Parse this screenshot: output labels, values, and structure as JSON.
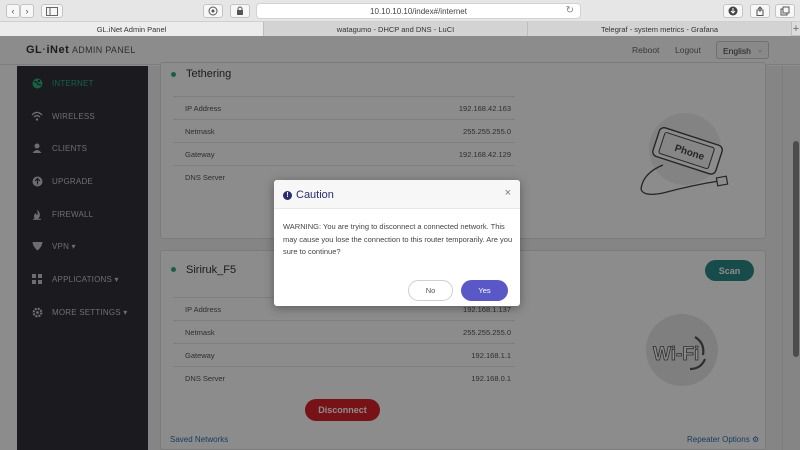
{
  "browser": {
    "url": "10.10.10.10/index#/internet",
    "tabs": [
      {
        "label": "GL.iNet Admin Panel",
        "active": true
      },
      {
        "label": "watagumo - DHCP and DNS - LuCI",
        "active": false
      },
      {
        "label": "Telegraf - system metrics - Grafana",
        "active": false
      }
    ]
  },
  "header": {
    "logo": {
      "part1": "GL",
      "dot": "·",
      "part2": "iNet"
    },
    "admin_title": "ADMIN PANEL",
    "reboot": "Reboot",
    "logout": "Logout",
    "language": "English"
  },
  "sidebar": {
    "items": [
      {
        "label": "INTERNET",
        "icon": "globe-icon",
        "active": true
      },
      {
        "label": "WIRELESS",
        "icon": "wifi-icon",
        "active": false
      },
      {
        "label": "CLIENTS",
        "icon": "user-icon",
        "active": false
      },
      {
        "label": "UPGRADE",
        "icon": "upload-icon",
        "active": false
      },
      {
        "label": "FIREWALL",
        "icon": "flame-icon",
        "active": false
      },
      {
        "label": "VPN ▾",
        "icon": "shield-icon",
        "active": false
      },
      {
        "label": "APPLICATIONS ▾",
        "icon": "grid-icon",
        "active": false
      },
      {
        "label": "MORE SETTINGS ▾",
        "icon": "gear-icon",
        "active": false
      }
    ]
  },
  "tethering": {
    "title": "Tethering",
    "rows": [
      {
        "key": "IP Address",
        "value": "192.168.42.163"
      },
      {
        "key": "Netmask",
        "value": "255.255.255.0"
      },
      {
        "key": "Gateway",
        "value": "192.168.42.129"
      },
      {
        "key": "DNS Server",
        "value": ""
      }
    ],
    "phone_label": "Phone"
  },
  "repeater": {
    "title": "Siriruk_F5",
    "scan_label": "Scan",
    "rows": [
      {
        "key": "IP Address",
        "value": "192.168.1.137"
      },
      {
        "key": "Netmask",
        "value": "255.255.255.0"
      },
      {
        "key": "Gateway",
        "value": "192.168.1.1"
      },
      {
        "key": "DNS Server",
        "value": "192.168.0.1"
      }
    ],
    "disconnect_label": "Disconnect",
    "saved_networks": "Saved Networks",
    "repeater_options": "Repeater Options",
    "wifi_label": "Wi-Fi"
  },
  "modal": {
    "title": "Caution",
    "message": "WARNING: You are trying to disconnect a connected network. This may cause you lose the connection to this router temporarily. Are you sure to continue?",
    "no_label": "No",
    "yes_label": "Yes"
  },
  "colors": {
    "accent_green": "#2ab27b",
    "sidebar_bg": "#30303a",
    "scan_btn": "#2b8a87",
    "disconnect_btn": "#d9232b",
    "yes_btn": "#5a58c7",
    "modal_title": "#2b2b6e"
  }
}
